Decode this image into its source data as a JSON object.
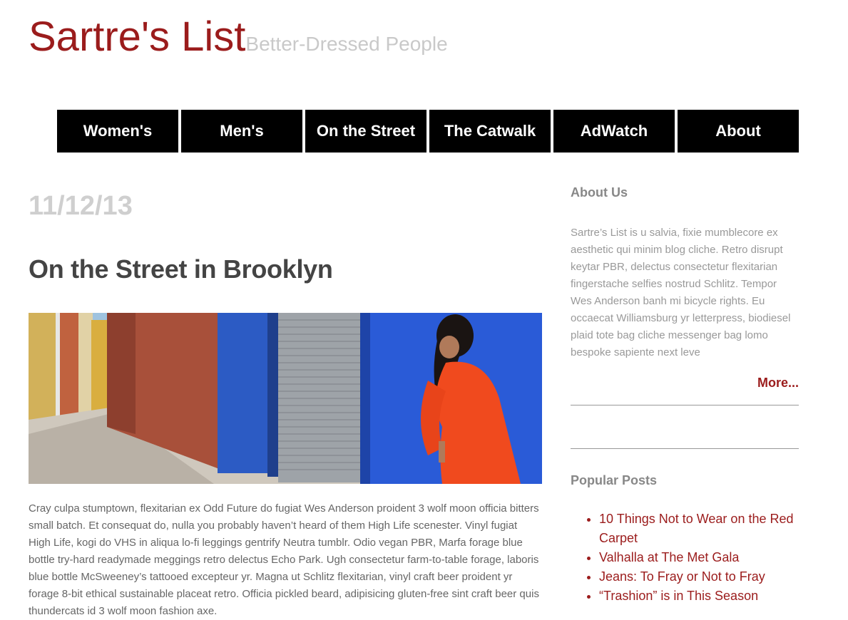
{
  "header": {
    "title": "Sartre's List",
    "tagline": "Better-Dressed People"
  },
  "nav": [
    "Women's",
    "Men's",
    "On the Street",
    "The Catwalk",
    "AdWatch",
    "About"
  ],
  "post": {
    "date": "11/12/13",
    "title": "On the Street in Brooklyn",
    "body": "Cray culpa stumptown, flexitarian ex Odd Future do fugiat Wes Anderson proident 3 wolf moon officia bitters small batch. Et consequat do, nulla you probably haven’t heard of them High Life scenester. Vinyl fugiat High Life, kogi do VHS in aliqua lo-fi leggings gentrify Neutra tumblr. Odio vegan PBR, Marfa forage blue bottle try-hard readymade meggings retro delectus Echo Park. Ugh consectetur farm-to-table forage, laboris blue bottle McSweeney’s tattooed excepteur yr. Magna ut Schlitz flexitarian, vinyl craft beer proident yr forage 8-bit ethical sustainable placeat retro. Officia pickled beard, adipisicing gluten-free sint craft beer quis thundercats id 3 wolf moon fashion axe."
  },
  "sidebar": {
    "about_title": "About Us",
    "about_text": "Sartre’s List is u salvia, fixie mumblecore ex aesthetic qui minim blog cliche. Retro disrupt keytar PBR, delectus consectetur flexitarian fingerstache selfies nostrud Schlitz. Tempor Wes Anderson banh mi bicycle rights. Eu occaecat Williamsburg yr letterpress, biodiesel plaid tote bag cliche messenger bag lomo bespoke sapiente next leve",
    "more_label": "More...",
    "popular_title": "Popular Posts",
    "popular": [
      "10 Things Not to Wear on the Red Carpet",
      "Valhalla at The Met Gala",
      "Jeans: To Fray or Not to Fray",
      "“Trashion” is in This Season"
    ]
  },
  "colors": {
    "brand": "#9b1c1c",
    "nav_bg": "#000000",
    "muted": "#cfcfcf"
  }
}
